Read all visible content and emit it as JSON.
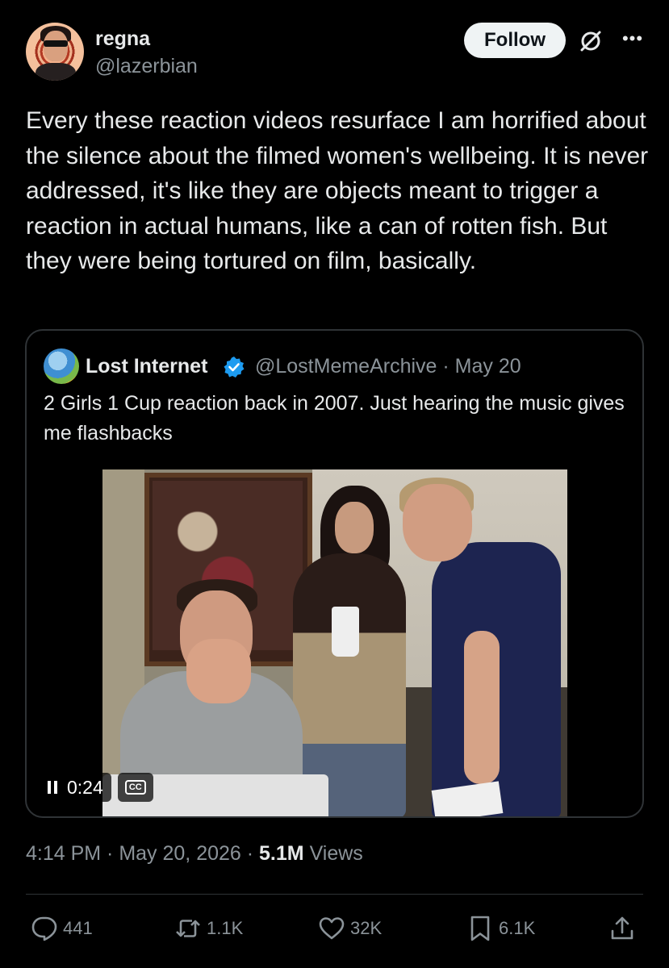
{
  "author": {
    "name": "regna",
    "handle": "@lazerbian",
    "follow_label": "Follow"
  },
  "tweet": {
    "text": "Every these reaction videos resurface I am horrified about the silence about the filmed women's wellbeing. It is never addressed, it's like they are objects meant to trigger a reaction in actual humans, like a can of rotten fish. But they were being tortured on film, basically."
  },
  "quote": {
    "name": "Lost Internet",
    "meta": "@LostMemeArchive · May 20",
    "text": "2 Girls 1 Cup reaction back in 2007. Just hearing the music gives me flashbacks",
    "video": {
      "time": "0:24",
      "cc": "CC"
    }
  },
  "timestamp": {
    "time_date": "4:14 PM · May 20, 2026 · ",
    "views_count": "5.1M",
    "views_label": " Views"
  },
  "actions": {
    "replies": "441",
    "reposts": "1.1K",
    "likes": "32K",
    "bookmarks": "6.1K"
  },
  "icons": {
    "grok": "grok-slash-icon",
    "more": "more-icon",
    "verified_color": "#1d9bf0"
  },
  "colors": {
    "background": "#000000",
    "text": "#e7e9ea",
    "muted": "#8b9399",
    "border": "#2f3336",
    "follow_bg": "#eff3f4"
  }
}
